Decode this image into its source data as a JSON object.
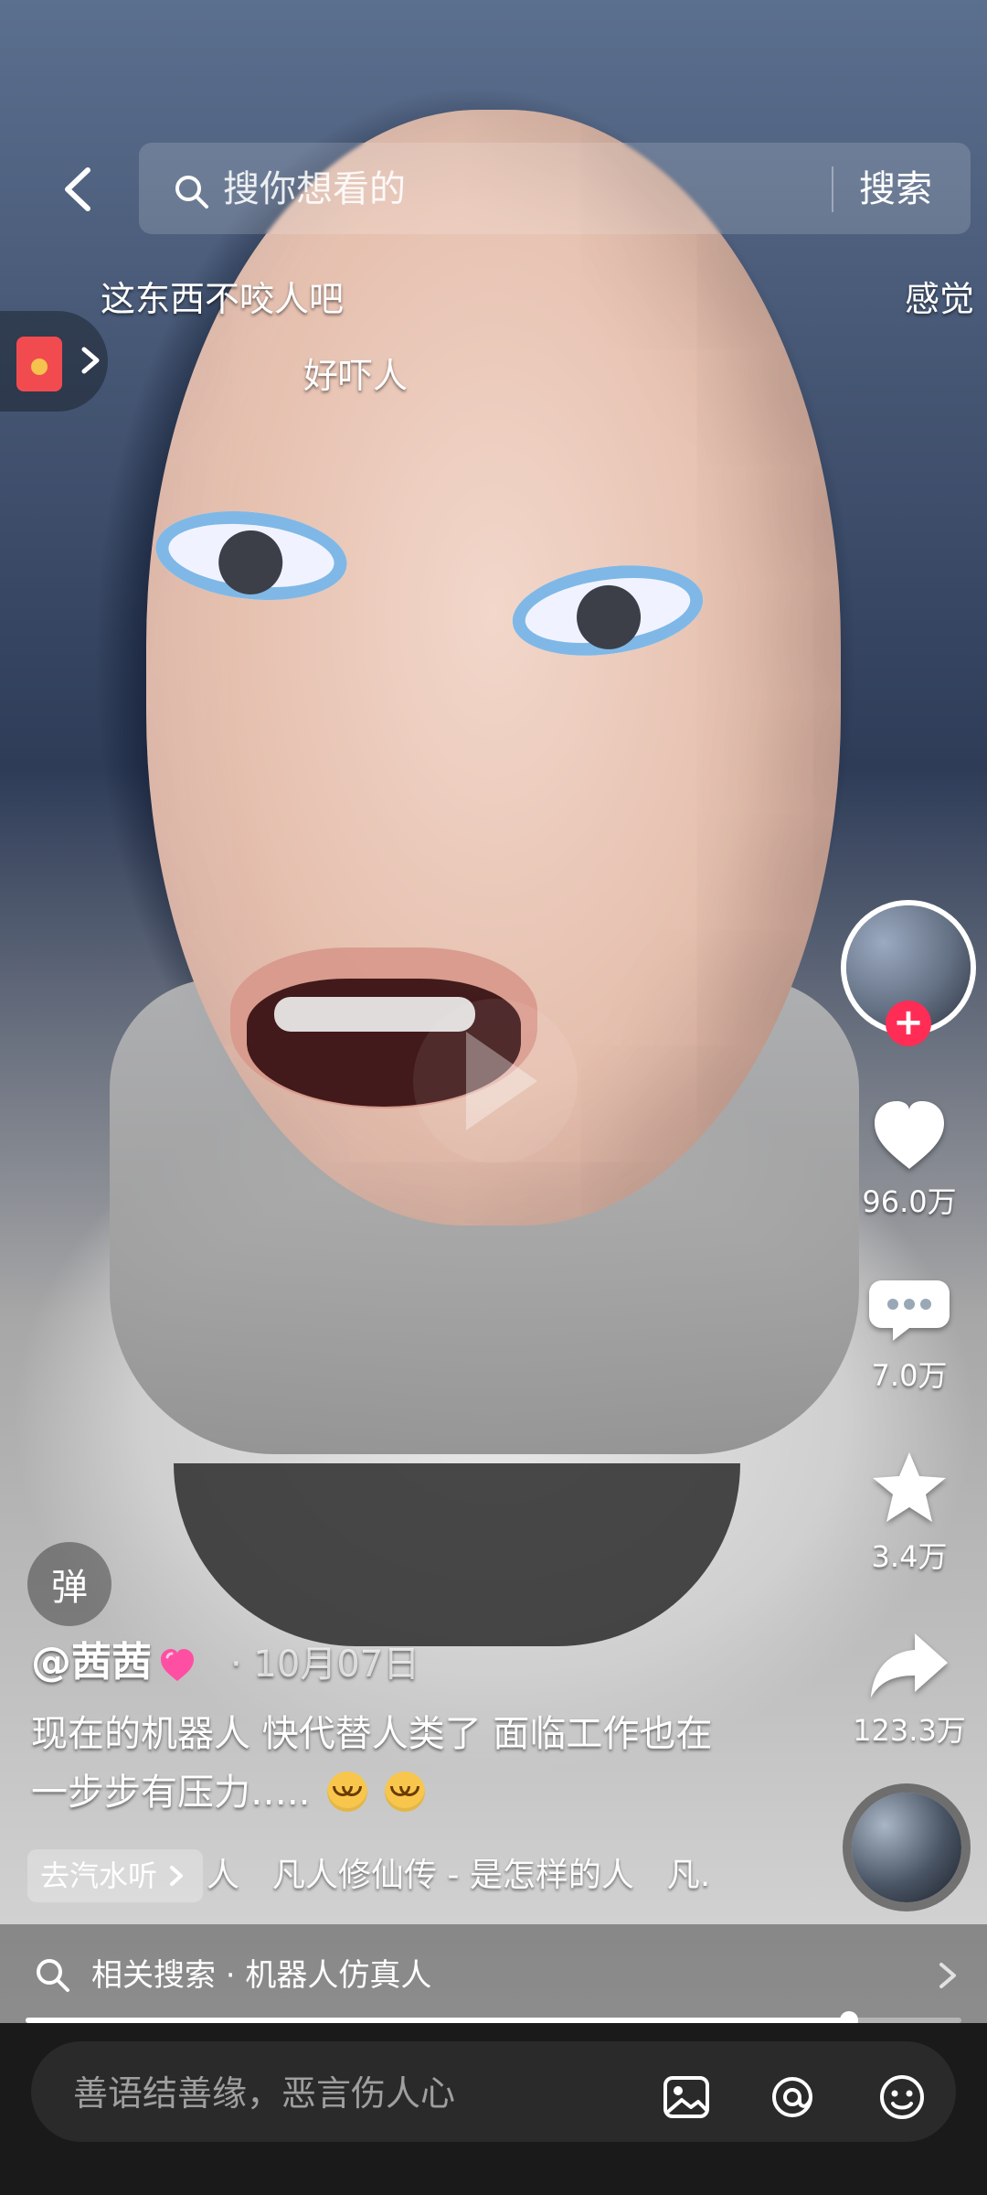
{
  "top_bar": {
    "search_placeholder": "搜你想看的",
    "search_button": "搜索"
  },
  "danmaku": [
    {
      "text": "这东西不咬人吧"
    },
    {
      "text": "好吓人"
    },
    {
      "text": "感觉"
    }
  ],
  "danmu_toggle": {
    "label": "弹"
  },
  "post": {
    "author": "@茜茜",
    "date": "· 10月07日",
    "caption_line1": "现在的机器人 快代替人类了 面临工作也在",
    "caption_line2": "一步步有压力….."
  },
  "music": {
    "tag": "去汽水听",
    "scroll_text": "人　凡人修仙传 - 是怎样的人　凡."
  },
  "related_search": {
    "label": "相关搜索 · 机器人仿真人"
  },
  "actions": {
    "likes": "96.0万",
    "comments": "7.0万",
    "favorites": "3.4万",
    "shares": "123.3万"
  },
  "progress": {
    "fraction": 0.88
  },
  "comment_input": {
    "placeholder": "善语结善缘，恶言伤人心"
  },
  "colors": {
    "accent": "#ff2d55",
    "bottom_bar": "#1a1a1a"
  }
}
